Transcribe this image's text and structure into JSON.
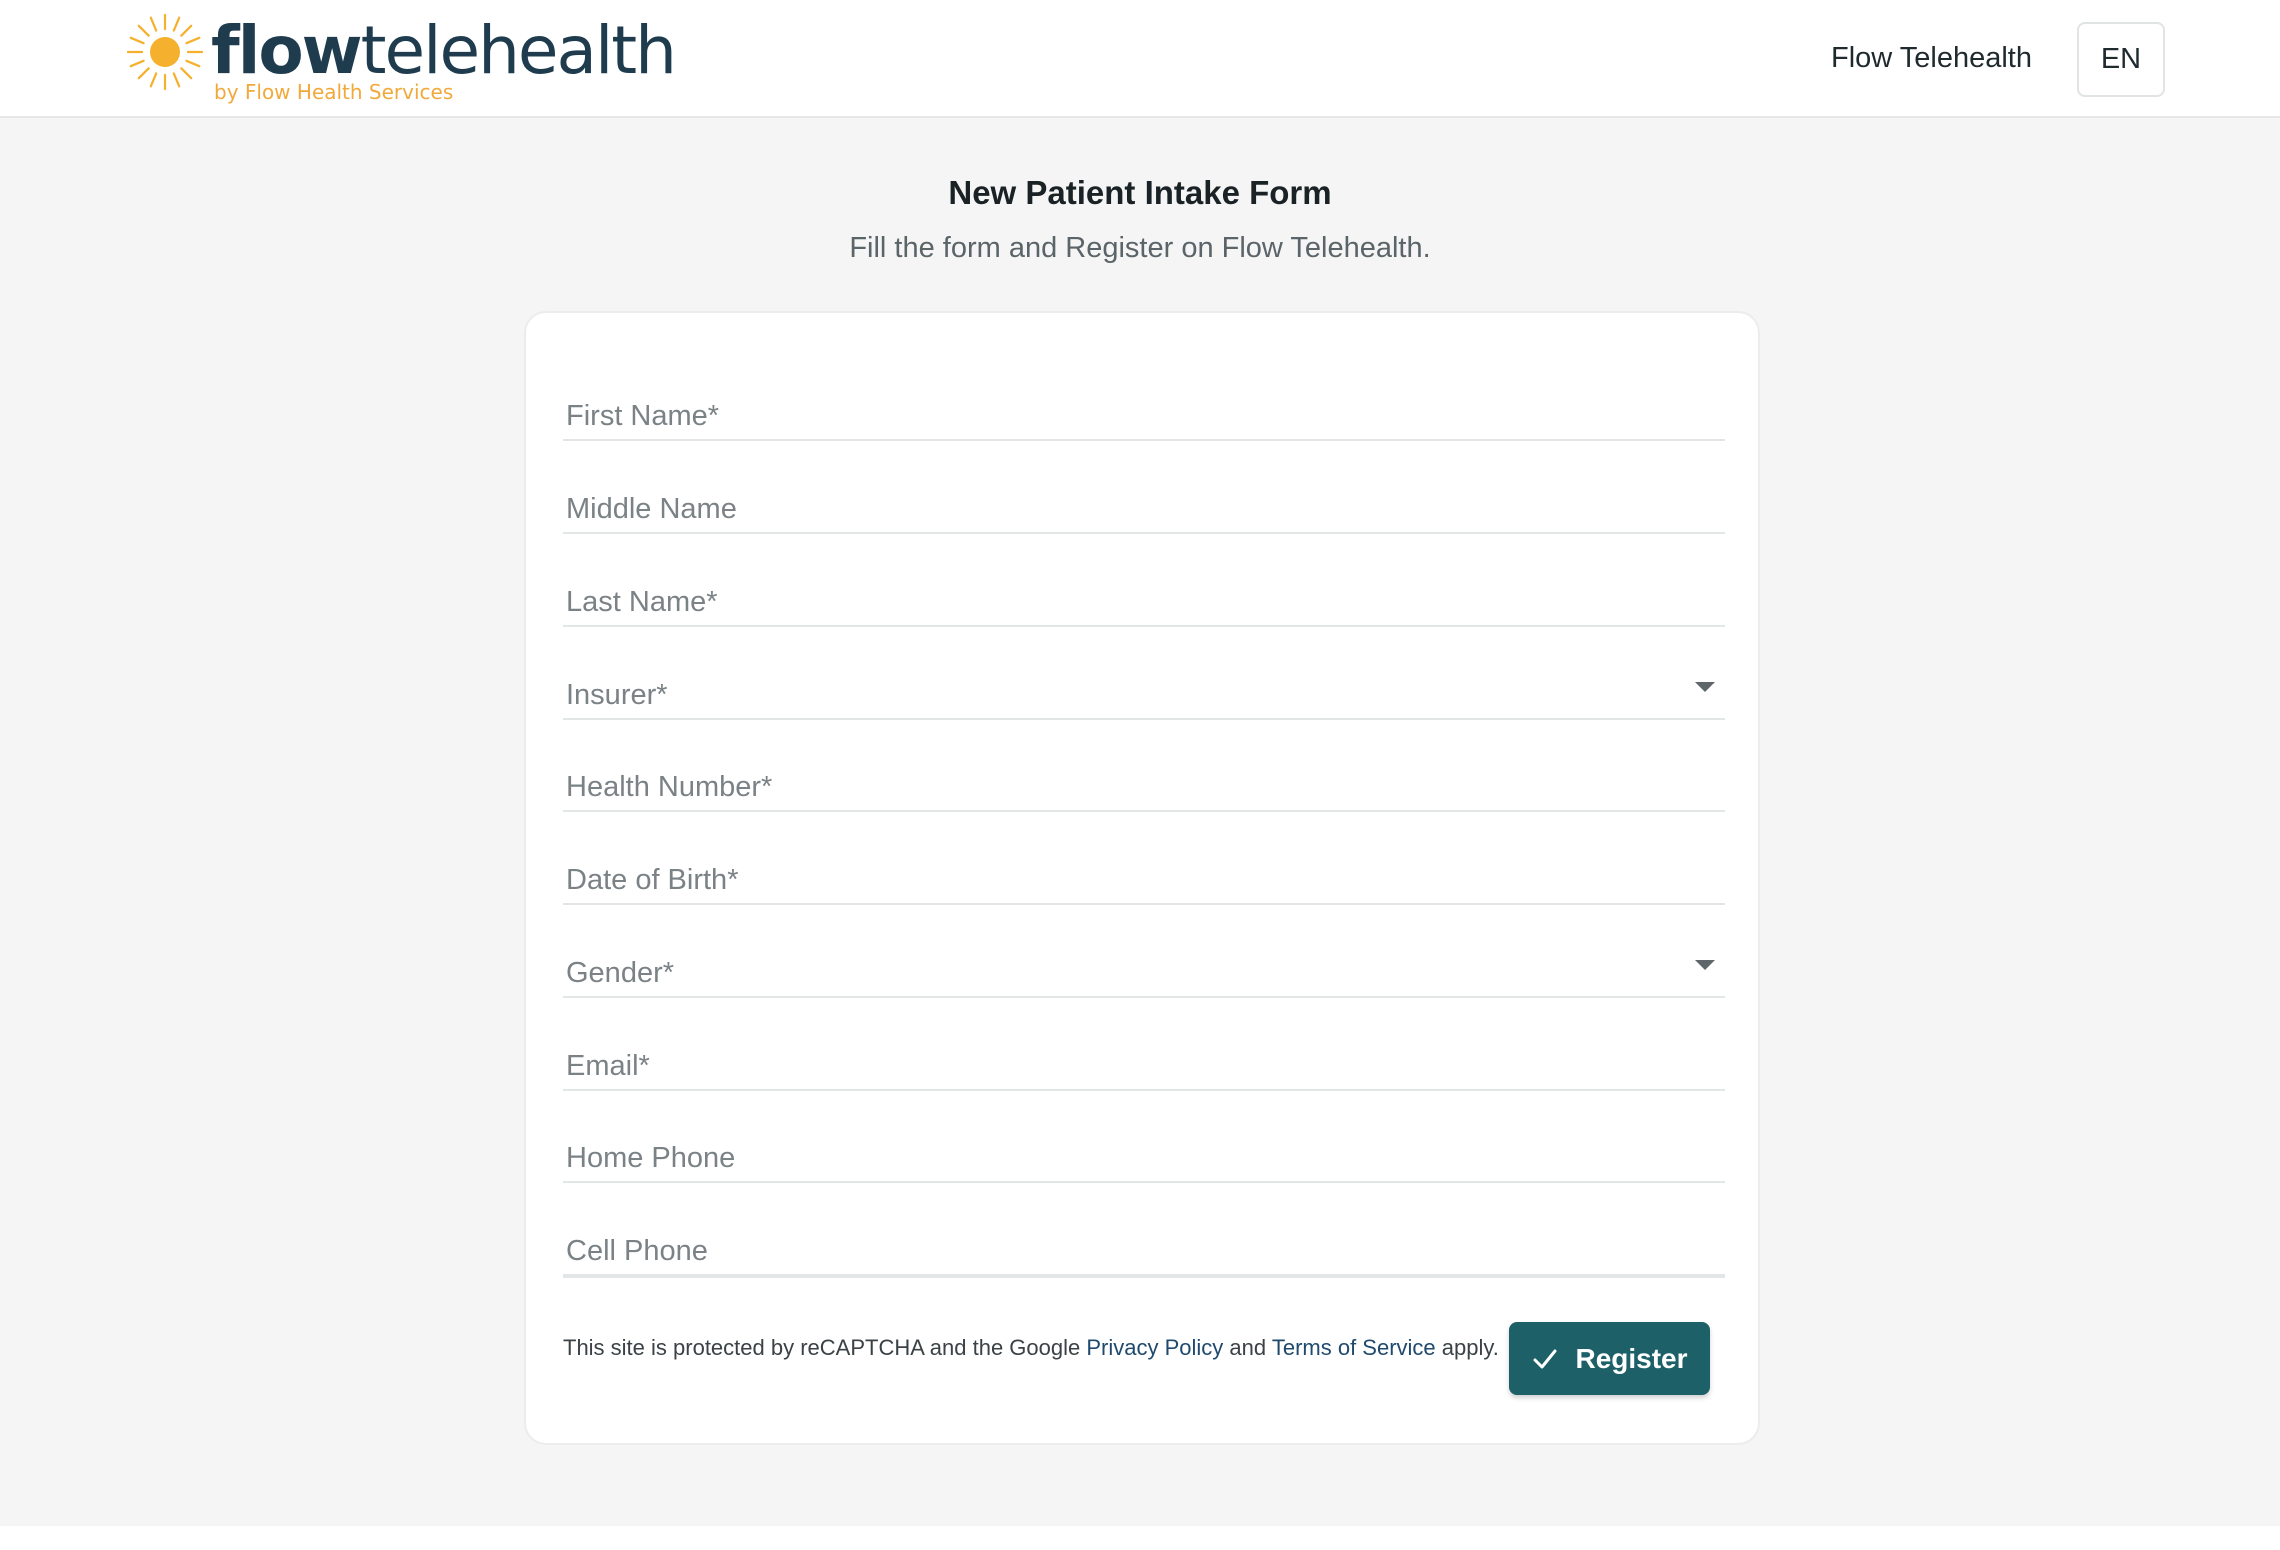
{
  "header": {
    "logo": {
      "word_strong": "flow",
      "word_light": "telehealth",
      "tagline": "by Flow Health Services",
      "icon": "sun-icon",
      "colors": {
        "word": "#1f3c4e",
        "tagline": "#f2a93b",
        "sun": "#f5b02e"
      }
    },
    "brand_link": "Flow Telehealth",
    "language": "EN"
  },
  "page": {
    "title": "New Patient Intake Form",
    "subtitle": "Fill the form and Register on Flow Telehealth."
  },
  "form": {
    "fields": [
      {
        "label": "First Name",
        "required": "*",
        "type": "text"
      },
      {
        "label": "Middle Name",
        "required": "",
        "type": "text"
      },
      {
        "label": "Last Name",
        "required": "*",
        "type": "text"
      },
      {
        "label": "Insurer",
        "required": "*",
        "type": "select"
      },
      {
        "label": "Health Number",
        "required": "*",
        "type": "text"
      },
      {
        "label": "Date of Birth",
        "required": "*",
        "type": "text"
      },
      {
        "label": "Gender",
        "required": "*",
        "type": "select"
      },
      {
        "label": "Email",
        "required": "*",
        "type": "text"
      },
      {
        "label": "Home Phone",
        "required": "",
        "type": "text"
      },
      {
        "label": "Cell Phone",
        "required": "",
        "type": "text"
      }
    ],
    "recaptcha": {
      "prefix": "This site is protected by reCAPTCHA and the Google ",
      "privacy_link": "Privacy Policy",
      "middle": " and ",
      "terms_link": "Terms of Service",
      "suffix": " apply."
    },
    "register_label": "Register",
    "register_icon": "check-icon",
    "colors": {
      "primary": "#1d6068",
      "link": "#1f4a6e"
    }
  }
}
